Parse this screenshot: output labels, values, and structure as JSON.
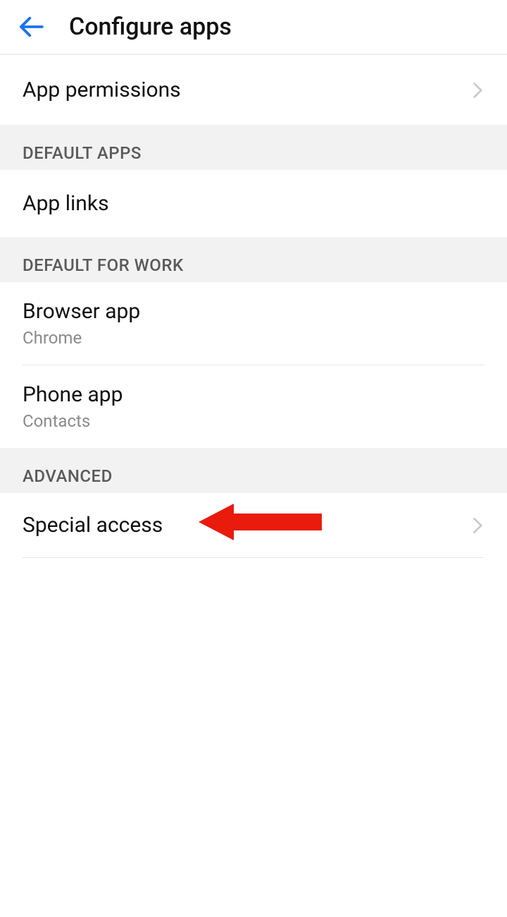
{
  "header": {
    "title": "Configure apps"
  },
  "rows": {
    "app_permissions": {
      "label": "App permissions"
    },
    "app_links": {
      "label": "App links"
    },
    "browser_app": {
      "label": "Browser app",
      "value": "Chrome"
    },
    "phone_app": {
      "label": "Phone app",
      "value": "Contacts"
    },
    "special_access": {
      "label": "Special access"
    }
  },
  "sections": {
    "default_apps": "DEFAULT APPS",
    "default_for_work": "DEFAULT FOR WORK",
    "advanced": "ADVANCED"
  }
}
